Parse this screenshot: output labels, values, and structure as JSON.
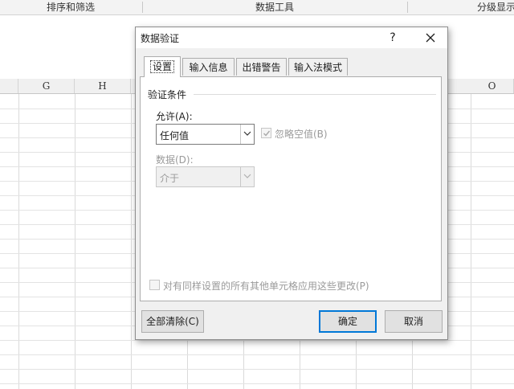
{
  "ribbon": {
    "groups": [
      "排序和筛选",
      "数据工具",
      "分级显示"
    ]
  },
  "sheet": {
    "columns": [
      "G",
      "H",
      "O"
    ]
  },
  "dialog": {
    "title": "数据验证",
    "help_label": "?",
    "close_label": "✕",
    "tabs": [
      {
        "label": "设置",
        "active": true
      },
      {
        "label": "输入信息",
        "active": false
      },
      {
        "label": "出错警告",
        "active": false
      },
      {
        "label": "输入法模式",
        "active": false
      }
    ],
    "section_title": "验证条件",
    "allow": {
      "label": "允许(A):",
      "value": "任何值"
    },
    "ignore_blank": {
      "label": "忽略空值(B)",
      "checked": true,
      "enabled": false
    },
    "data": {
      "label": "数据(D):",
      "value": "介于",
      "enabled": false
    },
    "apply_all": {
      "label": "对有同样设置的所有其他单元格应用这些更改(P)",
      "checked": false,
      "enabled": false
    },
    "buttons": {
      "clear_all": "全部清除(C)",
      "ok": "确定",
      "cancel": "取消"
    }
  },
  "colors": {
    "accent": "#0078d7",
    "dialog_bg": "#f0f0f0",
    "disabled_text": "#9a9a9a"
  }
}
